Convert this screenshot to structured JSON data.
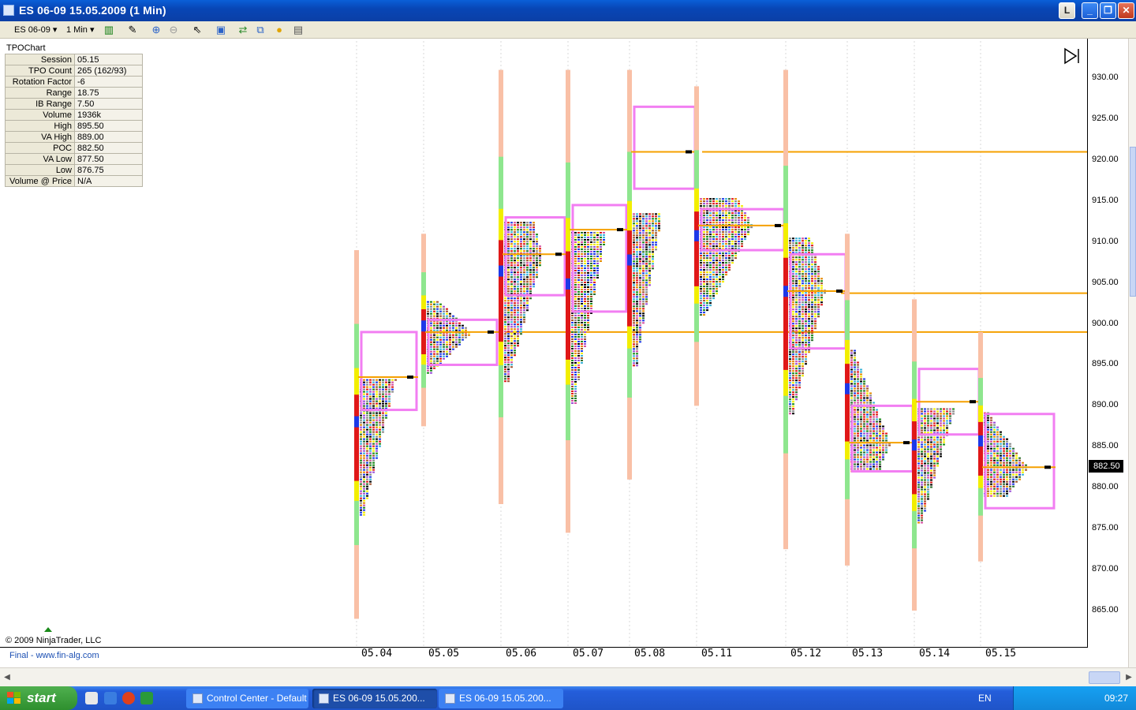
{
  "window": {
    "title": "ES 06-09  15.05.2009 (1 Min)"
  },
  "window_buttons": {
    "l": "L",
    "minimize": "_",
    "restore": "❐",
    "close": "✕"
  },
  "toolbar": {
    "instrument": "ES 06-09",
    "interval": "1 Min"
  },
  "info_panel": {
    "title": "TPOChart",
    "rows": [
      {
        "key": "Session",
        "value": "05.15"
      },
      {
        "key": "TPO Count",
        "value": "265 (162/93)"
      },
      {
        "key": "Rotation Factor",
        "value": "-6"
      },
      {
        "key": "Range",
        "value": "18.75"
      },
      {
        "key": "IB Range",
        "value": "7.50"
      },
      {
        "key": "Volume",
        "value": "1936k"
      },
      {
        "key": "High",
        "value": "895.50"
      },
      {
        "key": "VA High",
        "value": "889.00"
      },
      {
        "key": "POC",
        "value": "882.50"
      },
      {
        "key": "VA Low",
        "value": "877.50"
      },
      {
        "key": "Low",
        "value": "876.75"
      },
      {
        "key": "Volume @ Price",
        "value": "N/A"
      }
    ]
  },
  "footer": {
    "copyright": "© 2009 NinjaTrader, LLC",
    "link": "Final - www.fin-alg.com"
  },
  "price_axis": {
    "ticks": [
      "930.00",
      "925.00",
      "920.00",
      "915.00",
      "910.00",
      "905.00",
      "900.00",
      "895.00",
      "890.00",
      "885.00",
      "880.00",
      "875.00",
      "870.00",
      "865.00"
    ],
    "current_price": "882.50"
  },
  "chart_data": {
    "type": "tpo-market-profile",
    "sessions": [
      {
        "date": "05.04",
        "high": 909.0,
        "low": 864.0,
        "poc": 893.5,
        "va_high": 899.0,
        "va_low": 889.5
      },
      {
        "date": "05.05",
        "high": 911.0,
        "low": 887.5,
        "poc": 899.0,
        "va_high": 900.5,
        "va_low": 895.0
      },
      {
        "date": "05.06",
        "high": 931.0,
        "low": 878.0,
        "poc": 908.5,
        "va_high": 913.0,
        "va_low": 903.5
      },
      {
        "date": "05.07",
        "high": 931.0,
        "low": 874.5,
        "poc": 911.5,
        "va_high": 914.5,
        "va_low": 901.5
      },
      {
        "date": "05.08",
        "high": 931.0,
        "low": 881.0,
        "poc": 921.0,
        "va_high": 926.5,
        "va_low": 916.5
      },
      {
        "date": "05.11",
        "high": 929.0,
        "low": 890.0,
        "poc": 912.0,
        "va_high": 914.0,
        "va_low": 909.0
      },
      {
        "date": "05.12",
        "high": 931.0,
        "low": 872.5,
        "poc": 904.0,
        "va_high": 908.5,
        "va_low": 897.0
      },
      {
        "date": "05.13",
        "high": 911.0,
        "low": 870.5,
        "poc": 885.5,
        "va_high": 890.0,
        "va_low": 882.0
      },
      {
        "date": "05.14",
        "high": 903.0,
        "low": 865.0,
        "poc": 890.5,
        "va_high": 894.5,
        "va_low": 886.5
      },
      {
        "date": "05.15",
        "high": 899.0,
        "low": 871.0,
        "poc": 882.5,
        "va_high": 889.0,
        "va_low": 877.5
      }
    ],
    "naked_poc_lines": [
      921.0,
      903.75,
      899.0
    ],
    "ylim": [
      861.0,
      934.0
    ],
    "colors": {
      "value_area": "#f27ef2",
      "poc_line": "#f5a000",
      "range_bar_outer": "#f9c0a6",
      "range_bar_ib": "#8ee68e"
    }
  },
  "taskbar": {
    "start": "start",
    "tasks": [
      "Control Center - Default",
      "ES 06-09  15.05.200...",
      "ES 06-09  15.05.200..."
    ],
    "lang": "EN",
    "time": "09:27"
  }
}
